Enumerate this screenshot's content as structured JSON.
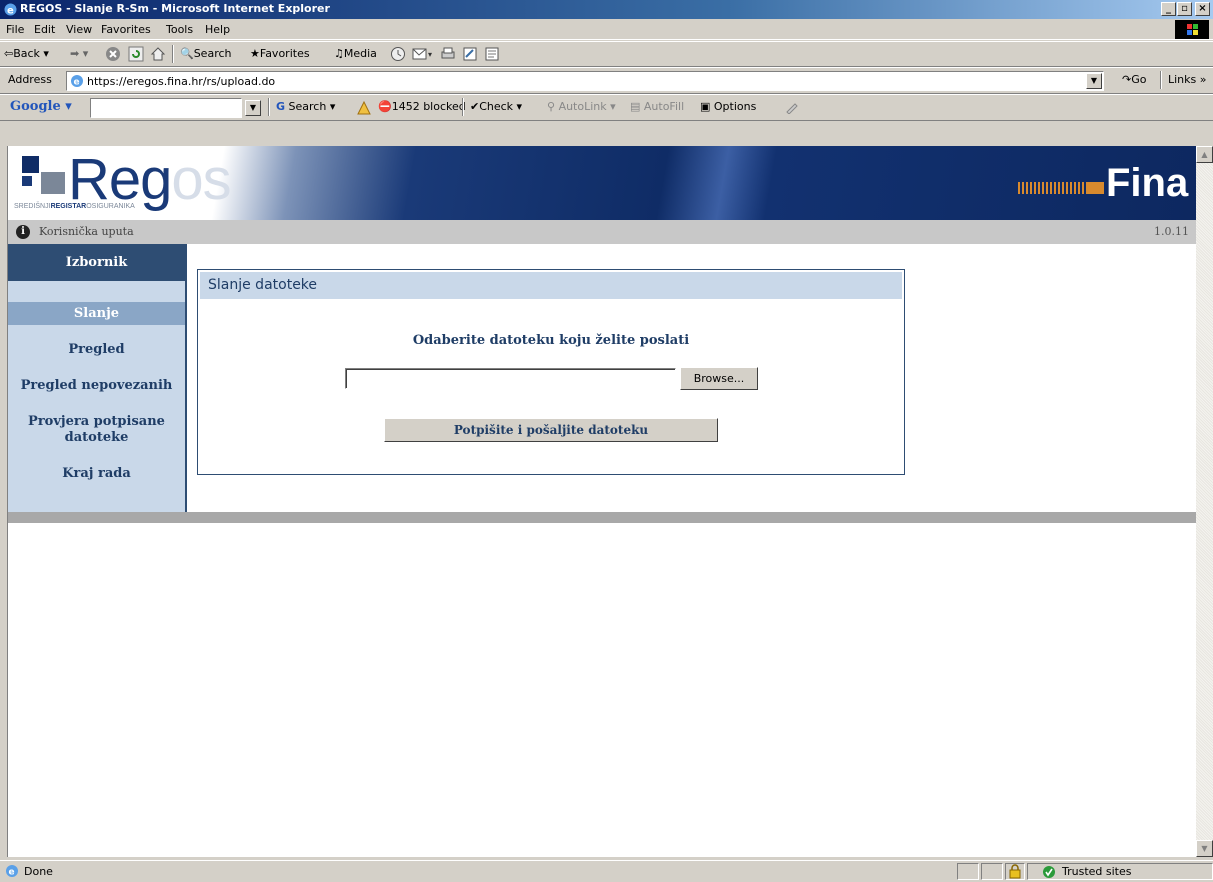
{
  "window": {
    "title": "REGOS - Slanje R-Sm - Microsoft Internet Explorer"
  },
  "menu": [
    "File",
    "Edit",
    "View",
    "Favorites",
    "Tools",
    "Help"
  ],
  "toolbar": {
    "back": "Back",
    "search": "Search",
    "favorites": "Favorites",
    "media": "Media"
  },
  "address": {
    "label": "Address",
    "url": "https://eregos.fina.hr/rs/upload.do",
    "go": "Go",
    "links": "Links"
  },
  "google_bar": {
    "logo": "Google",
    "search": "Search",
    "blocked": "1452 blocked",
    "check": "Check",
    "autolink": "AutoLink",
    "autofill": "AutoFill",
    "options": "Options"
  },
  "banner": {
    "logo_main": "Reg",
    "logo_tail": "os",
    "logo_sub_pre": "SREDIŠNJI",
    "logo_sub_bold": "REGISTAR",
    "logo_sub_post": "OSIGURANIKA",
    "partner": "Fina"
  },
  "infobar": {
    "help_link": "Korisnička uputa",
    "version": "1.0.11"
  },
  "sidebar": {
    "heading": "Izbornik",
    "items": [
      {
        "label": "Slanje",
        "active": true
      },
      {
        "label": "Pregled"
      },
      {
        "label": "Pregled nepovezanih"
      },
      {
        "label": "Provjera potpisane datoteke"
      },
      {
        "label": "Kraj rada"
      }
    ]
  },
  "form": {
    "title": "Slanje datoteke",
    "prompt": "Odaberite datoteku koju želite poslati",
    "file_value": "",
    "browse": "Browse...",
    "submit": "Potpišite i pošaljite datoteku"
  },
  "status": {
    "text": "Done",
    "zone": "Trusted sites"
  }
}
